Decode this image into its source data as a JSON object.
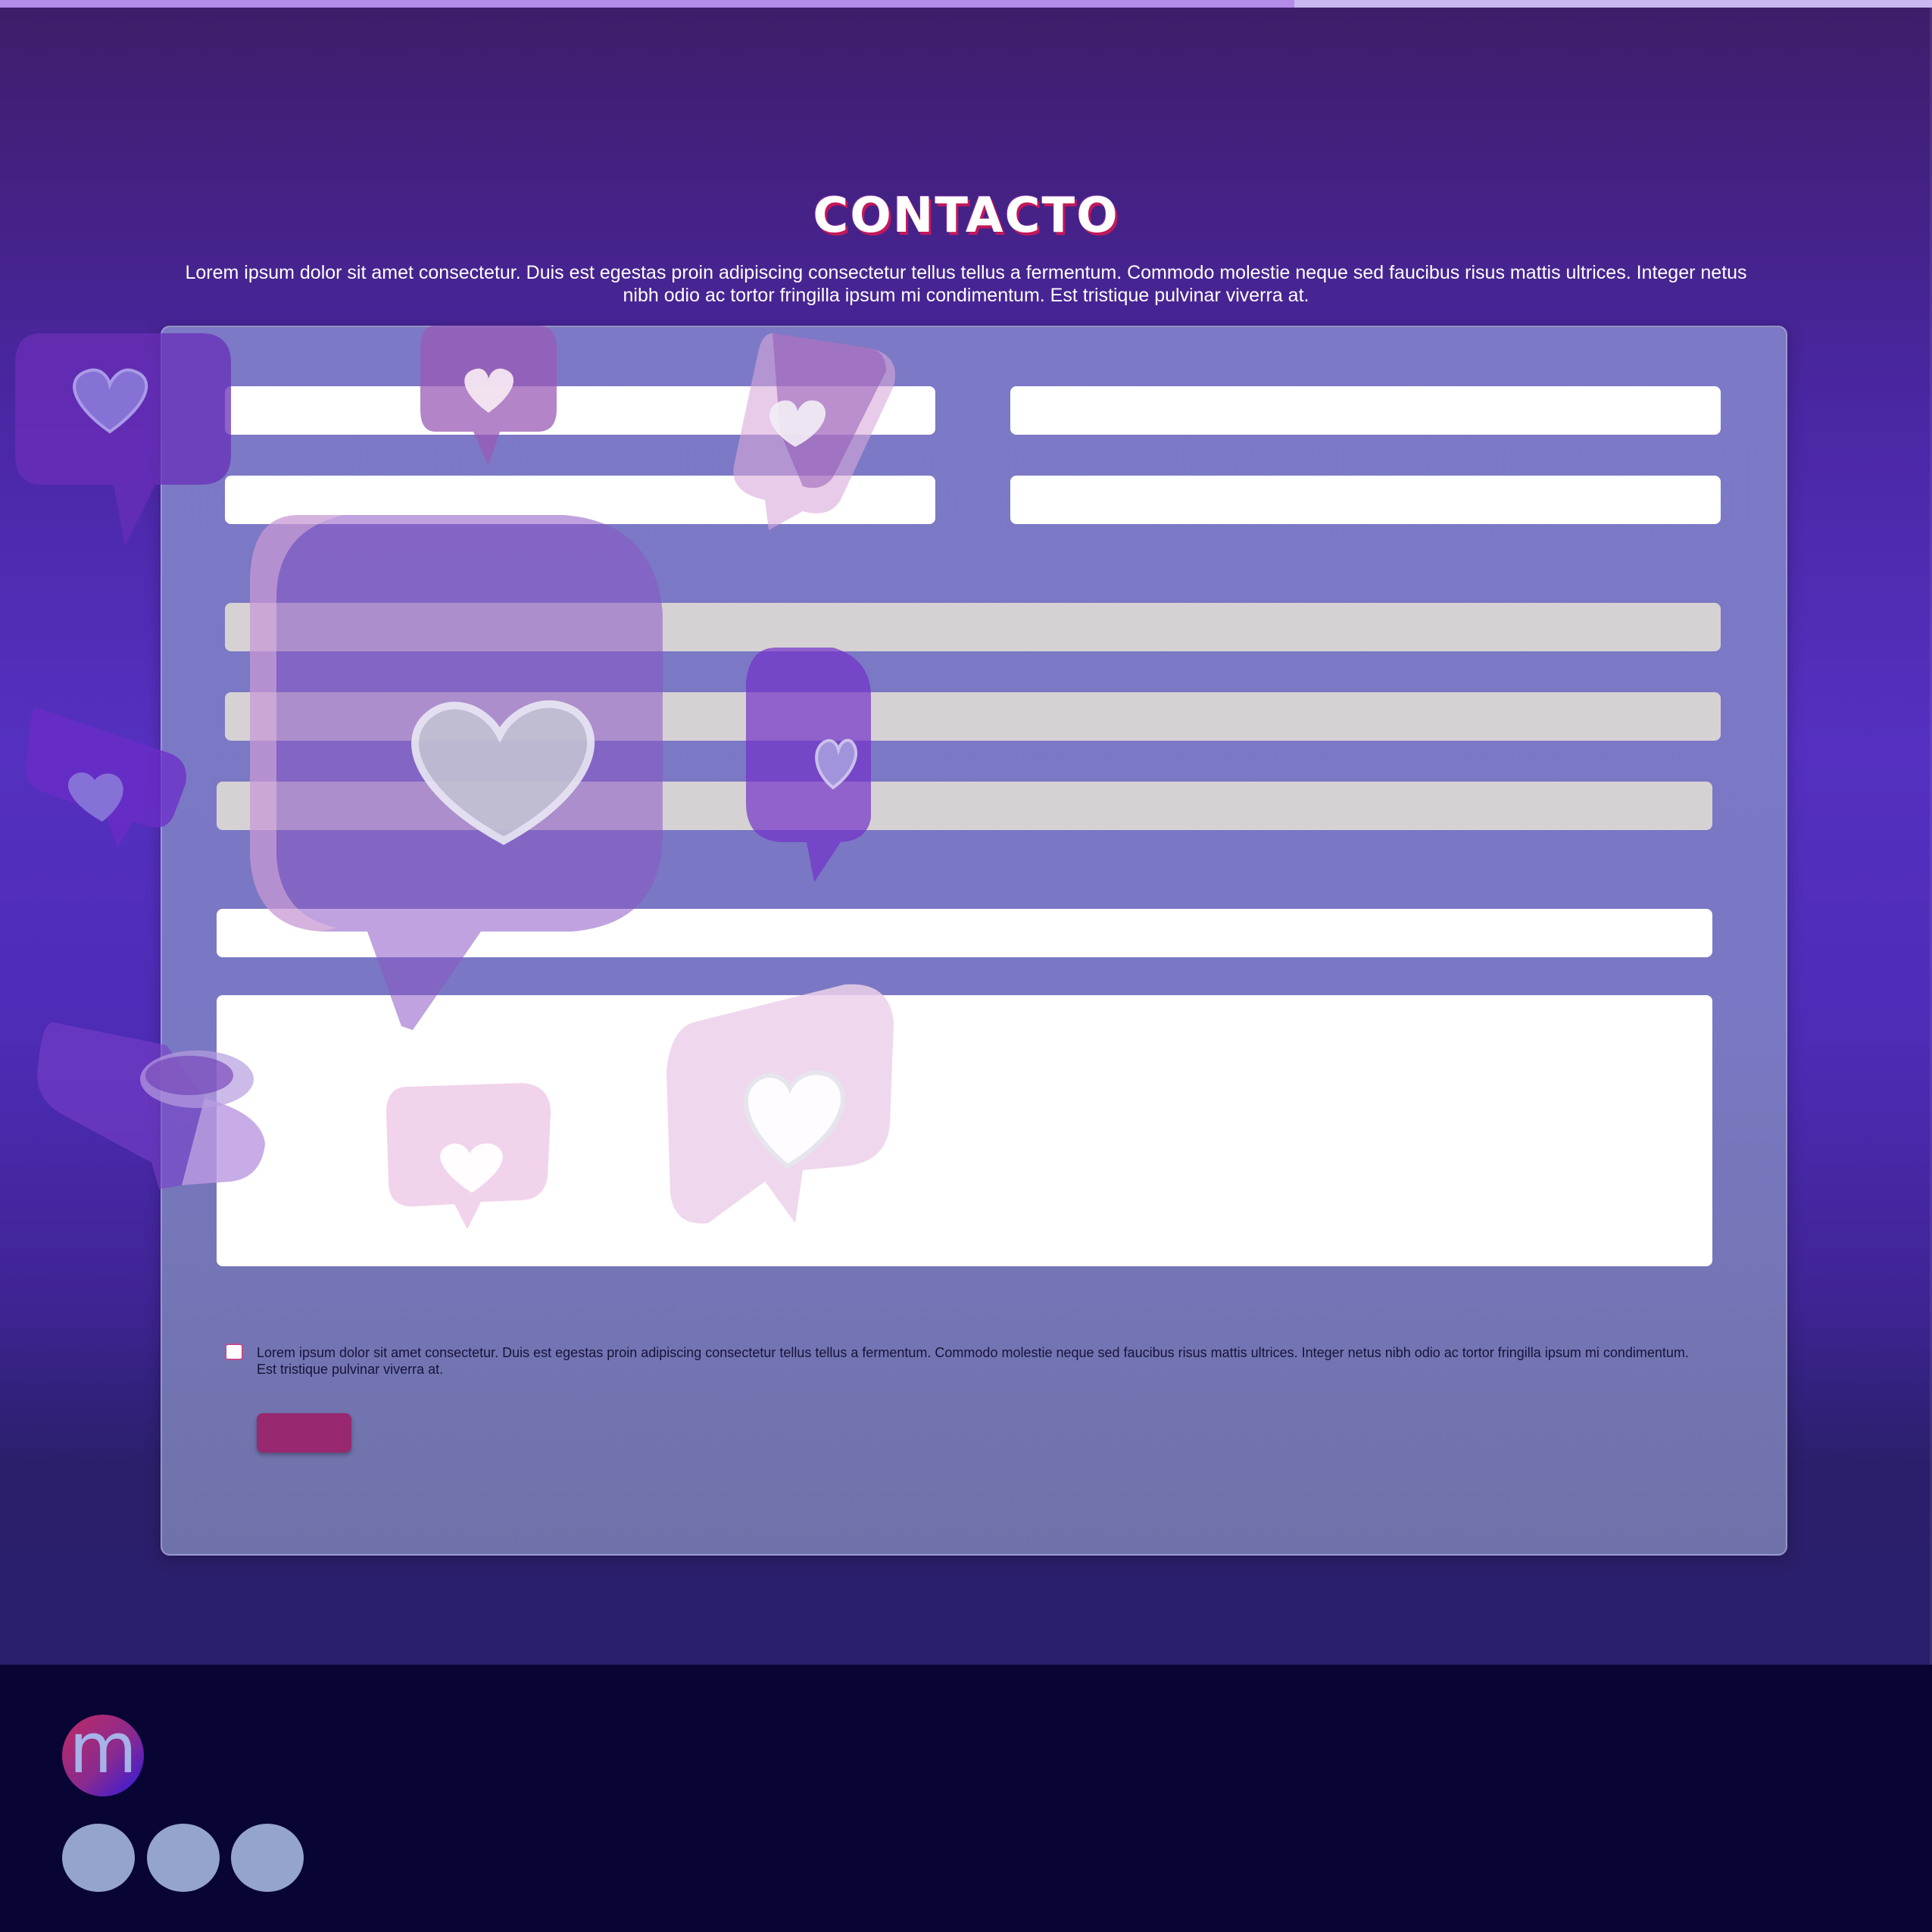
{
  "page": {
    "scroll_progress": 0.67,
    "colors": {
      "accent": "#98286f",
      "title_shadow": "#c2185b",
      "hero_top": "#3e1d69",
      "hero_mid": "#5530c0",
      "footer": "#080535",
      "social": "#95a4cf"
    }
  },
  "contact": {
    "title": "CONTACTO",
    "intro": "Lorem ipsum dolor sit amet consectetur. Duis est egestas proin adipiscing consectetur tellus tellus a fermentum. Commodo molestie neque sed faucibus risus mattis ultrices. Integer netus nibh odio ac tortor fringilla ipsum mi condimentum. Est tristique pulvinar viverra at.",
    "form": {
      "field1": {
        "value": "",
        "placeholder": ""
      },
      "field2": {
        "value": "",
        "placeholder": ""
      },
      "field3": {
        "value": "",
        "placeholder": ""
      },
      "field4": {
        "value": "",
        "placeholder": ""
      },
      "select1": {
        "value": ""
      },
      "select2": {
        "value": ""
      },
      "select3": {
        "value": ""
      },
      "field5": {
        "value": "",
        "placeholder": ""
      },
      "message": {
        "value": "",
        "placeholder": ""
      },
      "consent_checked": false,
      "consent_text": "Lorem ipsum dolor sit amet consectetur. Duis est egestas proin adipiscing consectetur tellus tellus a fermentum. Commodo molestie neque sed faucibus risus mattis ultrices. Integer netus nibh odio ac tortor fringilla ipsum mi condimentum. Est tristique pulvinar viverra at.",
      "submit_label": ""
    }
  },
  "footer": {
    "logo_letter": "m",
    "social_icons": [
      "social-icon-1",
      "social-icon-2",
      "social-icon-3"
    ]
  }
}
